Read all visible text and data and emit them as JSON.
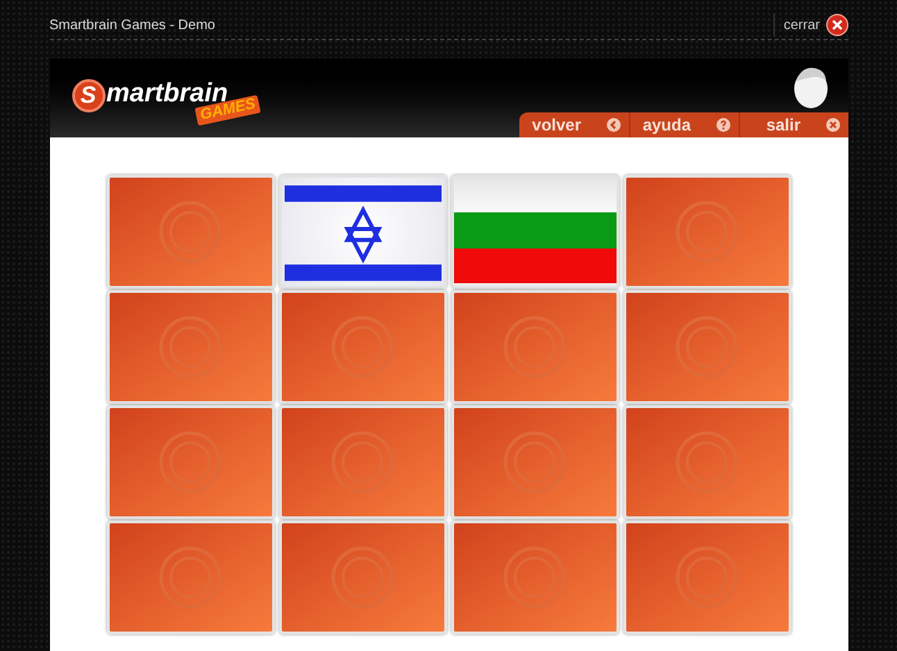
{
  "window": {
    "title": "Smartbrain Games - Demo",
    "close_label": "cerrar"
  },
  "logo": {
    "initial": "S",
    "name": "martbrain",
    "badge": "GAMES"
  },
  "menu": [
    {
      "label": "volver",
      "kind": "back"
    },
    {
      "label": "ayuda",
      "kind": "help"
    },
    {
      "label": "salir",
      "kind": "exit"
    }
  ],
  "cards": [
    {
      "kind": "back"
    },
    {
      "kind": "israel"
    },
    {
      "kind": "bulgaria"
    },
    {
      "kind": "back"
    },
    {
      "kind": "back"
    },
    {
      "kind": "back"
    },
    {
      "kind": "back"
    },
    {
      "kind": "back"
    },
    {
      "kind": "back"
    },
    {
      "kind": "back"
    },
    {
      "kind": "back"
    },
    {
      "kind": "back"
    },
    {
      "kind": "back"
    },
    {
      "kind": "back"
    },
    {
      "kind": "back"
    },
    {
      "kind": "back"
    }
  ]
}
